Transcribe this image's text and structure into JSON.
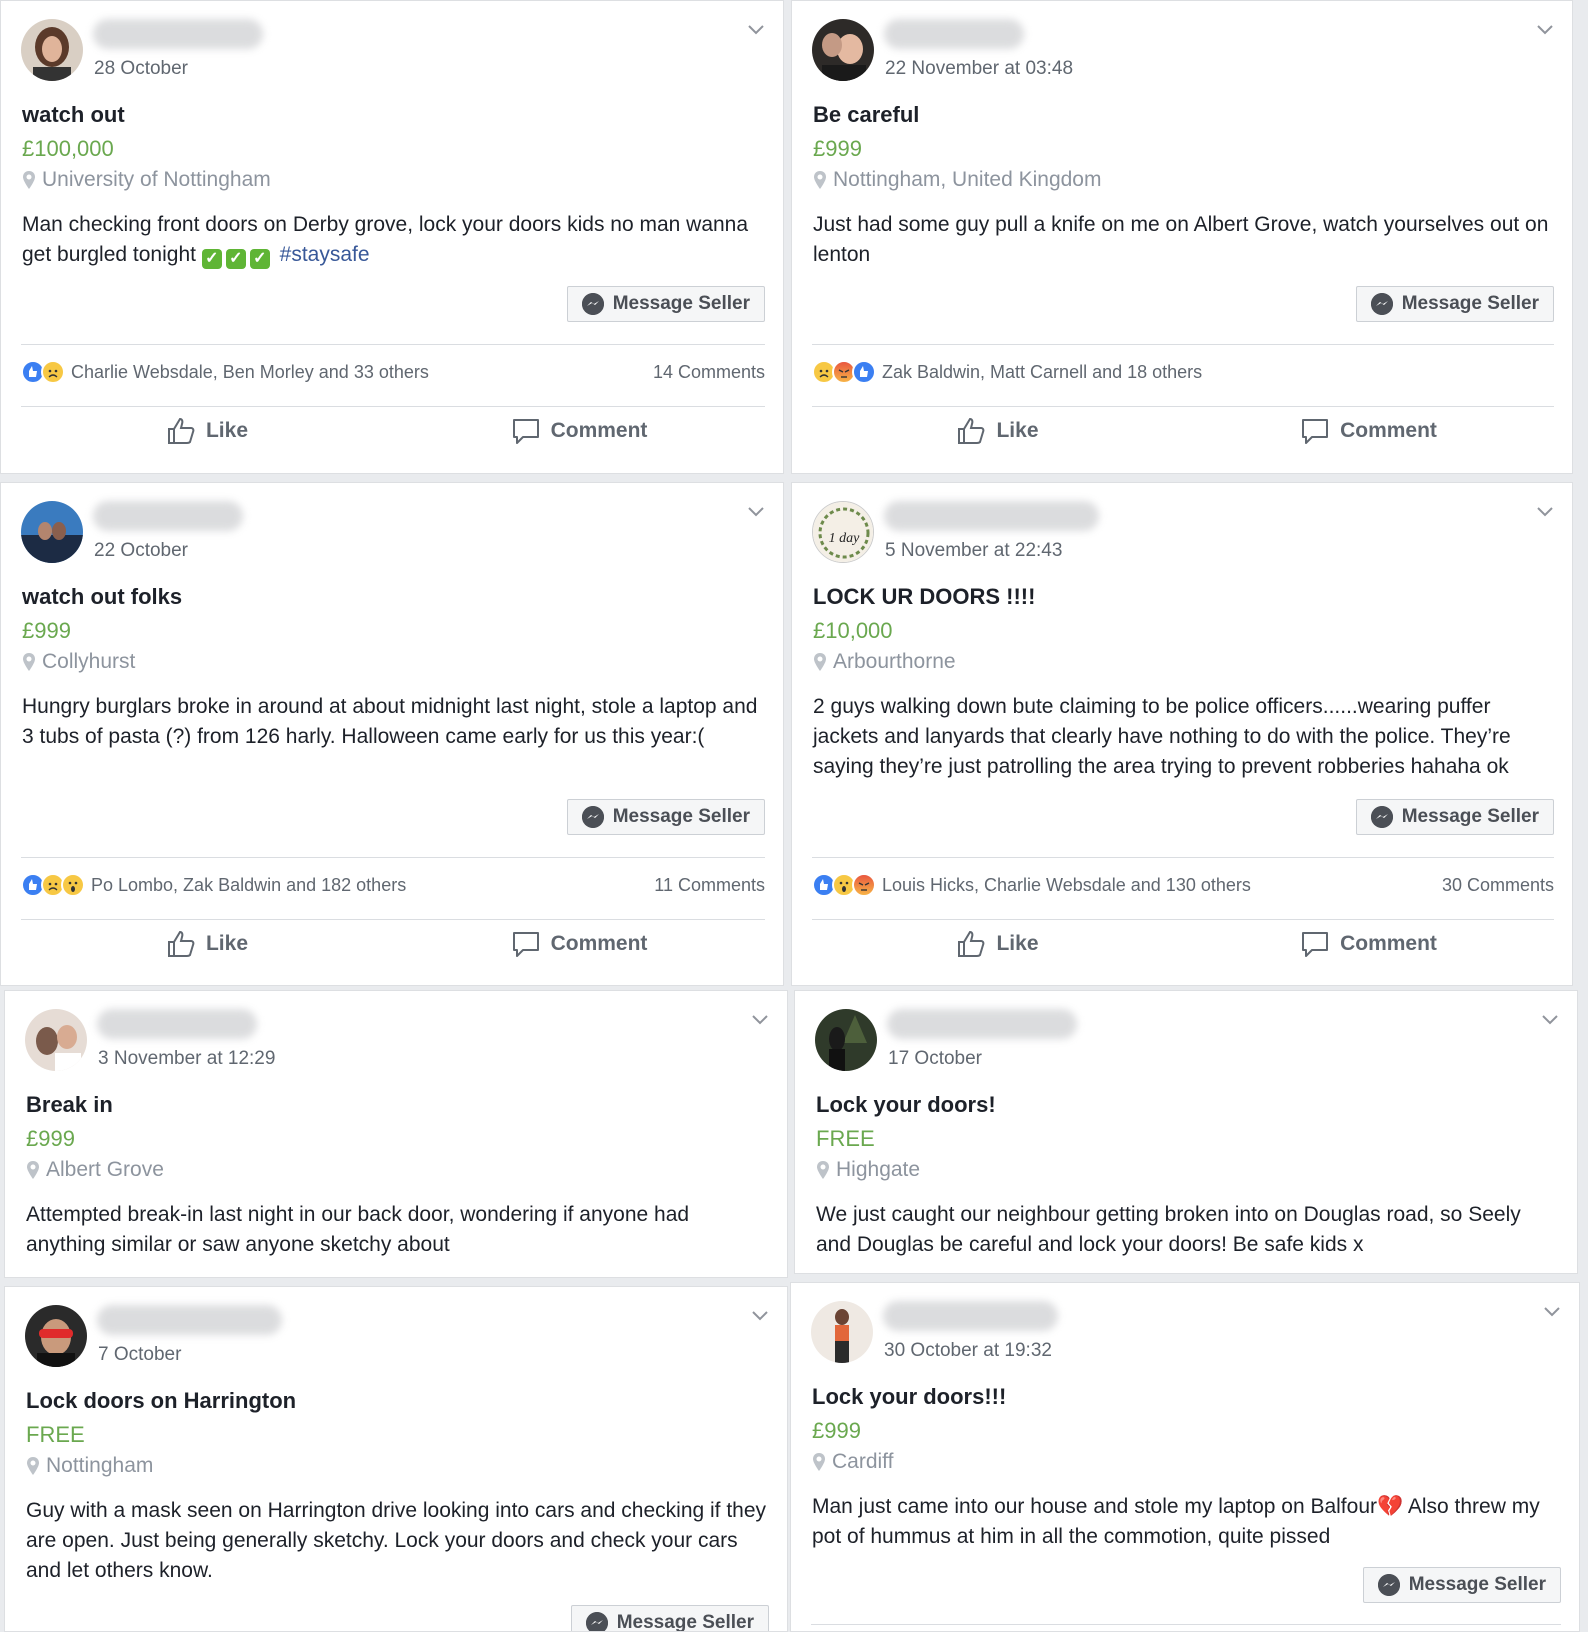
{
  "posts": [
    {
      "date": "28 October",
      "title": "watch out",
      "price": "£100,000",
      "location": "University of Nottingham",
      "body": "Man checking front doors on Derby grove, lock your doors kids no man wanna get burgled tonight",
      "checks": [
        "✓",
        "✓",
        "✓"
      ],
      "hashtag": "#staysafe",
      "message_label": "Message Seller",
      "reactions": [
        "like",
        "sad"
      ],
      "reaction_names": "Charlie Websdale, Ben Morley and 33 others",
      "comments": "14 Comments",
      "like_label": "Like",
      "comment_label": "Comment",
      "avatar_colors": [
        "#5b3a2a",
        "#b5836b"
      ]
    },
    {
      "date": "22 November at 03:48",
      "title": "Be careful",
      "price": "£999",
      "location": "Nottingham, United Kingdom",
      "body": "Just had some guy pull a knife on me on Albert Grove, watch yourselves out on lenton",
      "message_label": "Message Seller",
      "reactions": [
        "sad",
        "angry",
        "like"
      ],
      "reaction_names": "Zak Baldwin, Matt Carnell and 18 others",
      "comments": "",
      "like_label": "Like",
      "comment_label": "Comment",
      "avatar_colors": [
        "#2d2a28",
        "#c49a85"
      ]
    },
    {
      "date": "22 October",
      "title": "watch out folks",
      "price": "£999",
      "location": "Collyhurst",
      "body": "Hungry burglars broke in around at about midnight last night, stole a laptop and 3 tubs of pasta (?) from 126 harly. Halloween came early for us this year:(",
      "message_label": "Message Seller",
      "reactions": [
        "like",
        "sad",
        "wow"
      ],
      "reaction_names": "Po Lombo, Zak Baldwin and 182 others",
      "comments": "11 Comments",
      "like_label": "Like",
      "comment_label": "Comment",
      "avatar_colors": [
        "#3a7bbf",
        "#1c2b44"
      ]
    },
    {
      "date": "5 November at 22:43",
      "title": "LOCK UR DOORS !!!!",
      "price": "£10,000",
      "location": "Arbourthorne",
      "body": "2 guys walking down bute claiming to be police officers......wearing puffer jackets and lanyards that clearly have nothing to do with the police. They’re saying they’re just patrolling the area trying to prevent robberies hahaha ok",
      "message_label": "Message Seller",
      "reactions": [
        "like",
        "wow",
        "angry"
      ],
      "reaction_names": "Louis Hicks, Charlie Websdale and 130 others",
      "comments": "30 Comments",
      "like_label": "Like",
      "comment_label": "Comment",
      "avatar_text": "1 day",
      "avatar_colors": [
        "#f4efe6",
        "#6d8a4b"
      ]
    },
    {
      "date": "3 November at 12:29",
      "title": "Break in",
      "price": "£999",
      "location": "Albert Grove",
      "body": "Attempted break-in last night in our back door, wondering if anyone had anything similar or saw anyone sketchy about",
      "avatar_colors": [
        "#e6dcd5",
        "#7a5a4b"
      ]
    },
    {
      "date": "17 October",
      "title": "Lock your doors!",
      "price": "FREE",
      "location": "Highgate",
      "body": "We just caught our neighbour getting broken into on Douglas road, so Seely and Douglas be careful and lock your doors! Be safe kids x",
      "avatar_colors": [
        "#2f3a2a",
        "#4d5f3b"
      ]
    },
    {
      "date": "7 October",
      "title": "Lock doors on Harrington",
      "price": "FREE",
      "location": "Nottingham",
      "body": "Guy with a mask seen on Harrington drive looking into cars and checking if they are open. Just being generally sketchy. Lock your doors and check your cars and let others know.",
      "message_label": "Message Seller",
      "avatar_colors": [
        "#2a2a2a",
        "#e02b2b"
      ]
    },
    {
      "date": "30 October at 19:32",
      "title": "Lock your doors!!!",
      "price": "£999",
      "location": "Cardiff",
      "body": "Man just came into our house and stole my laptop on Balfour",
      "heart": "💔",
      "body_after": " Also threw my pot of hummus at him in all the commotion, quite pissed",
      "message_label": "Message Seller",
      "avatar_colors": [
        "#efe9e3",
        "#e2673b"
      ]
    }
  ]
}
